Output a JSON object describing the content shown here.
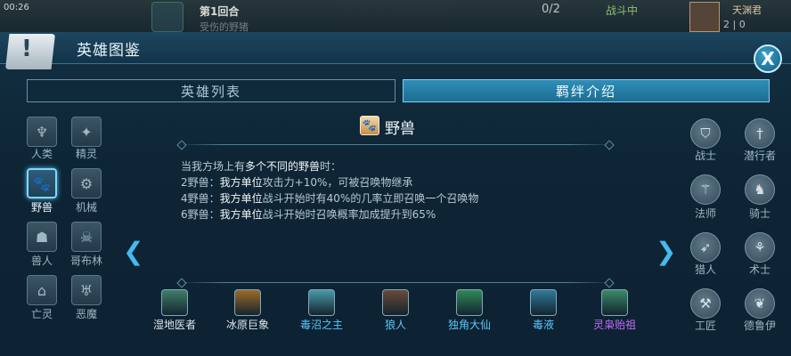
{
  "hud": {
    "time": "00:26",
    "round": "第1回合",
    "round_sub": "受伤的野猪",
    "counter": "0/2",
    "status": "战斗中",
    "player_name": "天渊君",
    "player_stats": "2 | 0"
  },
  "window": {
    "title": "英雄图鉴",
    "logo_glyph": "!",
    "close_glyph": "X"
  },
  "tabs": [
    {
      "label": "英雄列表",
      "active": false
    },
    {
      "label": "羁绊介绍",
      "active": true
    }
  ],
  "categories": [
    {
      "label": "人类",
      "icon": "human-icon",
      "glyph": "♆",
      "selected": false
    },
    {
      "label": "精灵",
      "icon": "elf-icon",
      "glyph": "✦",
      "selected": false
    },
    {
      "label": "野兽",
      "icon": "paw-icon",
      "glyph": "🐾",
      "selected": true
    },
    {
      "label": "机械",
      "icon": "gear-icon",
      "glyph": "⚙",
      "selected": false
    },
    {
      "label": "兽人",
      "icon": "orc-icon",
      "glyph": "☗",
      "selected": false
    },
    {
      "label": "哥布林",
      "icon": "goblin-icon",
      "glyph": "☠",
      "selected": false
    },
    {
      "label": "亡灵",
      "icon": "undead-icon",
      "glyph": "⌂",
      "selected": false
    },
    {
      "label": "恶魔",
      "icon": "demon-icon",
      "glyph": "♅",
      "selected": false
    }
  ],
  "classes": [
    {
      "label": "战士",
      "icon": "shield-icon",
      "glyph": "⛉"
    },
    {
      "label": "潜行者",
      "icon": "dagger-icon",
      "glyph": "†"
    },
    {
      "label": "法师",
      "icon": "staff-icon",
      "glyph": "⚚"
    },
    {
      "label": "骑士",
      "icon": "horse-icon",
      "glyph": "♞"
    },
    {
      "label": "猎人",
      "icon": "bow-icon",
      "glyph": "➶"
    },
    {
      "label": "术士",
      "icon": "orb-icon",
      "glyph": "⚘"
    },
    {
      "label": "工匠",
      "icon": "hammer-icon",
      "glyph": "⚒"
    },
    {
      "label": "德鲁伊",
      "icon": "bear-icon",
      "glyph": "❦"
    }
  ],
  "bond": {
    "name": "野兽",
    "icon": "paw-icon",
    "icon_glyph": "🐾",
    "intro_prefix": "当我方场上有",
    "intro_highlight": "多个不同的野兽",
    "intro_suffix": "时：",
    "tiers": [
      {
        "count": "2野兽：",
        "target": "我方单位",
        "effect": "攻击力+10%，可被召唤物继承"
      },
      {
        "count": "4野兽：",
        "target": "我方单位",
        "effect": "战斗开始时有40%的几率立即召唤一个召唤物"
      },
      {
        "count": "6野兽：",
        "target": "我方单位",
        "effect": "战斗开始时召唤概率加成提升到65%"
      }
    ]
  },
  "nav": {
    "prev_glyph": "❮",
    "next_glyph": "❯"
  },
  "heroes": [
    {
      "name": "湿地医者",
      "color": "#dfe7ec",
      "portrait": "#3f7f6a"
    },
    {
      "name": "冰原巨象",
      "color": "#dfe7ec",
      "portrait": "#a06a2a"
    },
    {
      "name": "毒沼之主",
      "color": "#58c7ff",
      "portrait": "#4a9aa8"
    },
    {
      "name": "狼人",
      "color": "#58c7ff",
      "portrait": "#6a4a38"
    },
    {
      "name": "独角大仙",
      "color": "#58c7ff",
      "portrait": "#2f8a5a"
    },
    {
      "name": "毒液",
      "color": "#58c7ff",
      "portrait": "#2f7a9a"
    },
    {
      "name": "灵枭贻祖",
      "color": "#c26bff",
      "portrait": "#3a8a6a"
    }
  ]
}
